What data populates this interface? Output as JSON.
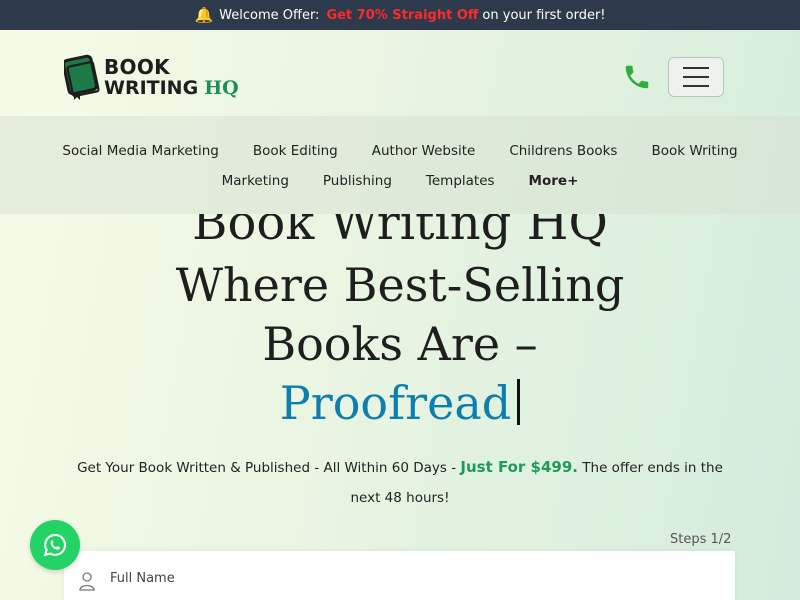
{
  "topbar": {
    "prefix": "Welcome Offer:",
    "highlight": "Get 70% Straight Off",
    "suffix": "on your first order!",
    "highlight_color": "#ff2a2a",
    "icon": "bell-icon"
  },
  "logo": {
    "line1": "BOOK",
    "line2": "WRITING",
    "line2_accent": "HQ",
    "icon": "book-icon"
  },
  "header": {
    "phone_icon": "phone-icon",
    "menu_icon": "hamburger-icon"
  },
  "nav": {
    "row1": [
      "Social Media Marketing",
      "Book Editing",
      "Author Website",
      "Childrens Books",
      "Book Writing"
    ],
    "row2": [
      "Marketing",
      "Publishing",
      "Templates"
    ],
    "more": "More+"
  },
  "hero": {
    "cut_line": "Book Writing HQ",
    "line1": "Where Best-Selling",
    "line2": "Books Are –",
    "rotating_word": "Proofread",
    "accent_color": "#0d7fae"
  },
  "subtext": {
    "before": "Get Your Book Written & Published - All Within 60 Days -",
    "price": "Just For $499.",
    "after": "The offer ends in the next 48 hours!",
    "price_color": "#1f9a5a"
  },
  "form": {
    "steps": "Steps 1/2",
    "full_name_placeholder": "Full Name",
    "full_name_value": ""
  },
  "whatsapp": {
    "icon": "whatsapp-icon",
    "color": "#24d366"
  }
}
